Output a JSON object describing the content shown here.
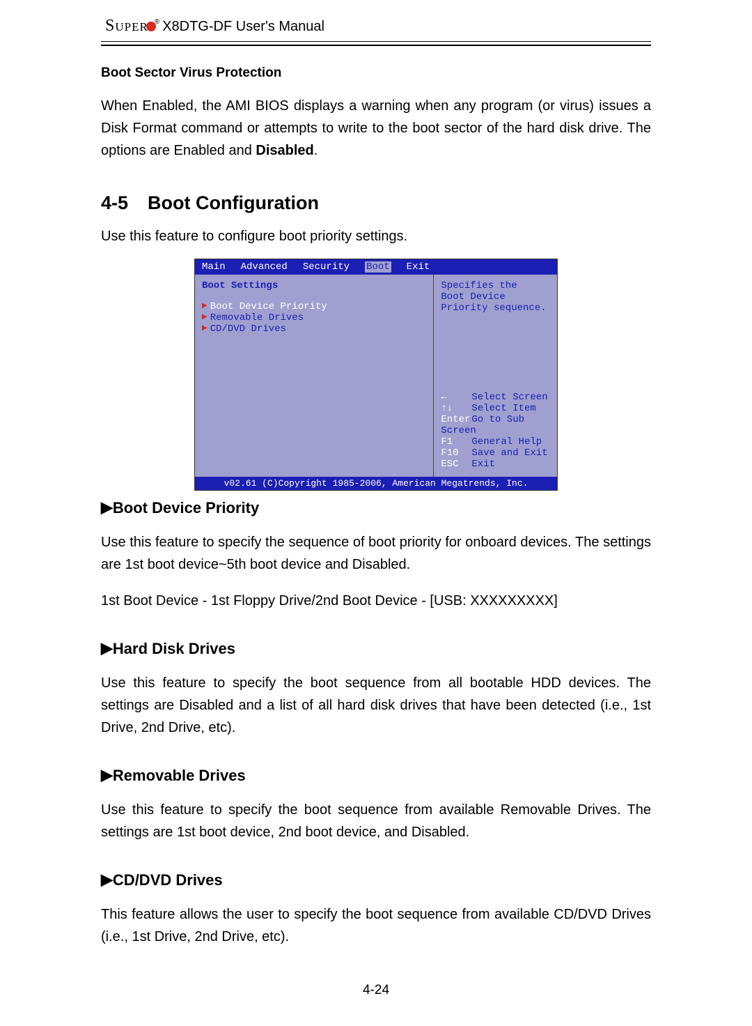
{
  "header": {
    "brand": "Super",
    "reg_mark": "®",
    "manual_title": "X8DTG-DF User's Manual"
  },
  "boot_sector": {
    "heading": "Boot Sector Virus Protection",
    "body_part1": "When Enabled, the AMI BIOS displays a warning when any program (or virus) issues a Disk Format command or attempts to write to the boot sector of the hard disk drive. The options are Enabled and ",
    "bold": "Disabled",
    "body_part2": "."
  },
  "section": {
    "number": "4-5",
    "title": "Boot Configuration",
    "intro": "Use this feature to configure boot priority settings."
  },
  "bios": {
    "tabs": [
      "Main",
      "Advanced",
      "Security",
      "Boot",
      "Exit"
    ],
    "left_heading": "Boot Settings",
    "items": [
      "Boot Device Priority",
      "Removable Drives",
      "CD/DVD Drives"
    ],
    "right_desc_l1": "Specifies the",
    "right_desc_l2": "Boot Device",
    "right_desc_l3": "Priority sequence.",
    "nav": [
      {
        "key": "←",
        "label": "Select Screen"
      },
      {
        "key": "↑↓",
        "label": "Select Item"
      },
      {
        "key": "Enter",
        "label": "Go to Sub Screen"
      },
      {
        "key": "F1",
        "label": "General Help"
      },
      {
        "key": "F10",
        "label": "Save and Exit"
      },
      {
        "key": "ESC",
        "label": "Exit"
      }
    ],
    "footer": "v02.61 (C)Copyright 1985-2006, American Megatrends, Inc."
  },
  "boot_device_priority": {
    "heading": "Boot Device Priority",
    "p1": "Use this feature to specify the sequence of boot priority for onboard devices. The settings are 1st boot device~5th boot device and Disabled.",
    "p2": "1st Boot Device - 1st Floppy Drive/2nd Boot Device - [USB: XXXXXXXXX]"
  },
  "hard_disk": {
    "heading": "Hard Disk Drives",
    "p1": "Use this feature to specify the boot sequence from all bootable HDD devices. The settings are Disabled and a list of all hard disk drives that have been detected (i.e., 1st Drive, 2nd Drive, etc)."
  },
  "removable": {
    "heading": "Removable Drives",
    "p1": "Use this feature to specify the boot sequence from available Removable Drives. The settings are 1st boot device, 2nd boot device, and Disabled."
  },
  "cddvd": {
    "heading": "CD/DVD Drives",
    "p1": "This feature allows the user to specify the boot sequence from available CD/DVD Drives (i.e., 1st Drive, 2nd Drive, etc)."
  },
  "page_number": "4-24",
  "glyphs": {
    "triangle": "▶"
  }
}
